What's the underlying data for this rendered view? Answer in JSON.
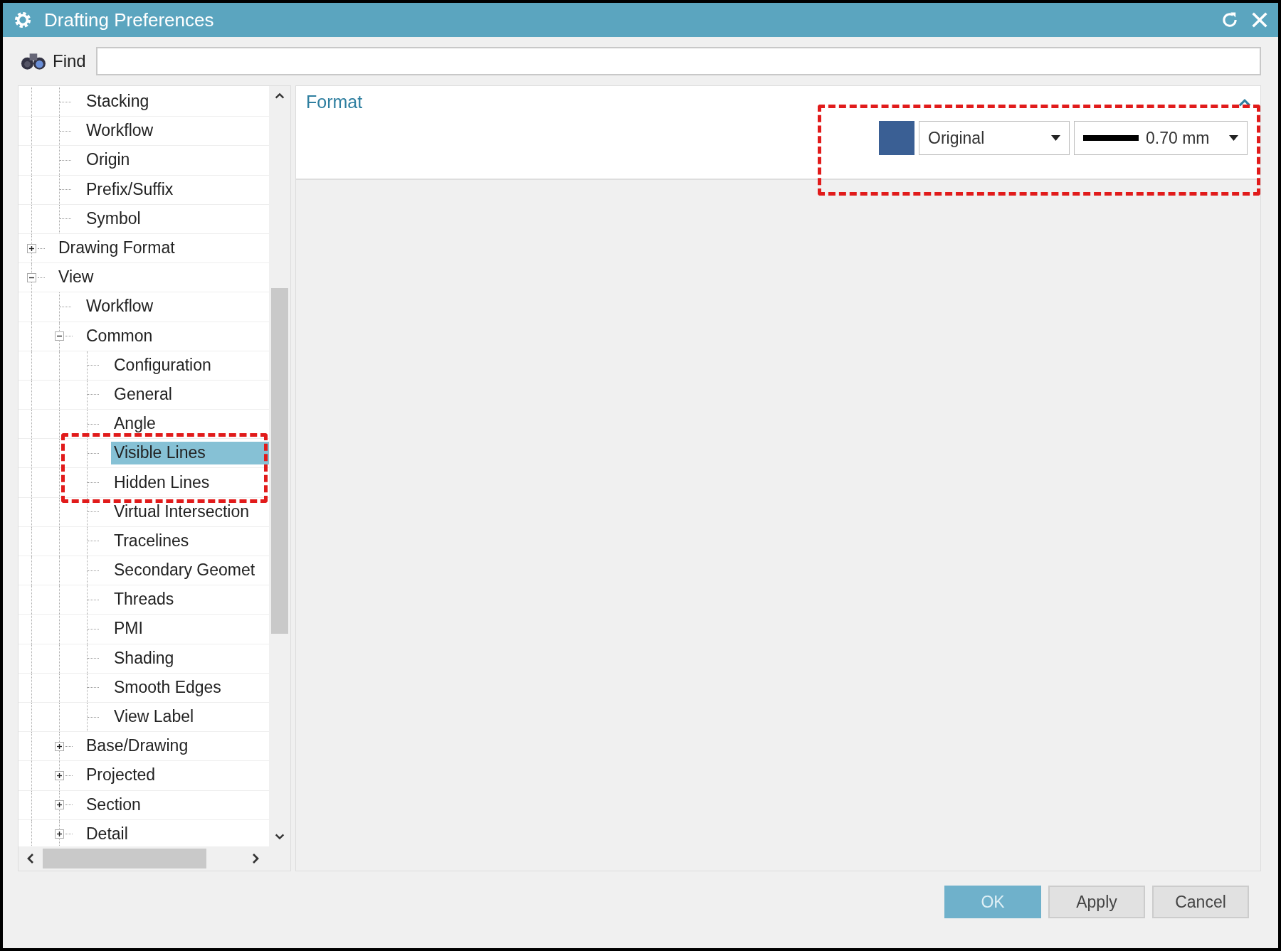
{
  "window": {
    "title": "Drafting Preferences"
  },
  "find": {
    "label": "Find"
  },
  "tree": {
    "items": [
      {
        "children": [
          {
            "label": "Stacking",
            "selected": false
          },
          {
            "label": "Workflow",
            "selected": false
          },
          {
            "label": "Origin",
            "selected": false
          },
          {
            "label": "Prefix/Suffix",
            "selected": false
          },
          {
            "label": "Symbol",
            "selected": false
          }
        ]
      },
      {
        "label": "Drawing Format",
        "selected": false,
        "expanded": false
      },
      {
        "label": "View",
        "selected": false,
        "expanded": true,
        "children": [
          {
            "label": "Workflow",
            "selected": false
          },
          {
            "label": "Common",
            "selected": false,
            "expanded": true,
            "children": [
              {
                "label": "Configuration",
                "selected": false
              },
              {
                "label": "General",
                "selected": false
              },
              {
                "label": "Angle",
                "selected": false
              },
              {
                "label": "Visible Lines",
                "selected": true
              },
              {
                "label": "Hidden Lines",
                "selected": false
              },
              {
                "label": "Virtual Intersection",
                "selected": false
              },
              {
                "label": "Tracelines",
                "selected": false
              },
              {
                "label": "Secondary Geomet",
                "selected": false
              },
              {
                "label": "Threads",
                "selected": false
              },
              {
                "label": "PMI",
                "selected": false
              },
              {
                "label": "Shading",
                "selected": false
              },
              {
                "label": "Smooth Edges",
                "selected": false
              },
              {
                "label": "View Label",
                "selected": false
              }
            ]
          },
          {
            "label": "Base/Drawing",
            "selected": false,
            "expanded": false
          },
          {
            "label": "Projected",
            "selected": false,
            "expanded": false
          },
          {
            "label": "Section",
            "selected": false,
            "expanded": false
          },
          {
            "label": "Detail",
            "selected": false,
            "expanded": false
          }
        ]
      }
    ]
  },
  "format": {
    "title": "Format",
    "expanded": true,
    "swatch": {
      "color": "#3a5f94"
    },
    "font_dropdown": {
      "value": "Original"
    },
    "width_dropdown": {
      "value": "0.70 mm"
    }
  },
  "buttons": [
    {
      "label": "OK",
      "kind": "primary"
    },
    {
      "label": "Apply",
      "kind": "secondary"
    },
    {
      "label": "Cancel",
      "kind": "secondary"
    }
  ]
}
